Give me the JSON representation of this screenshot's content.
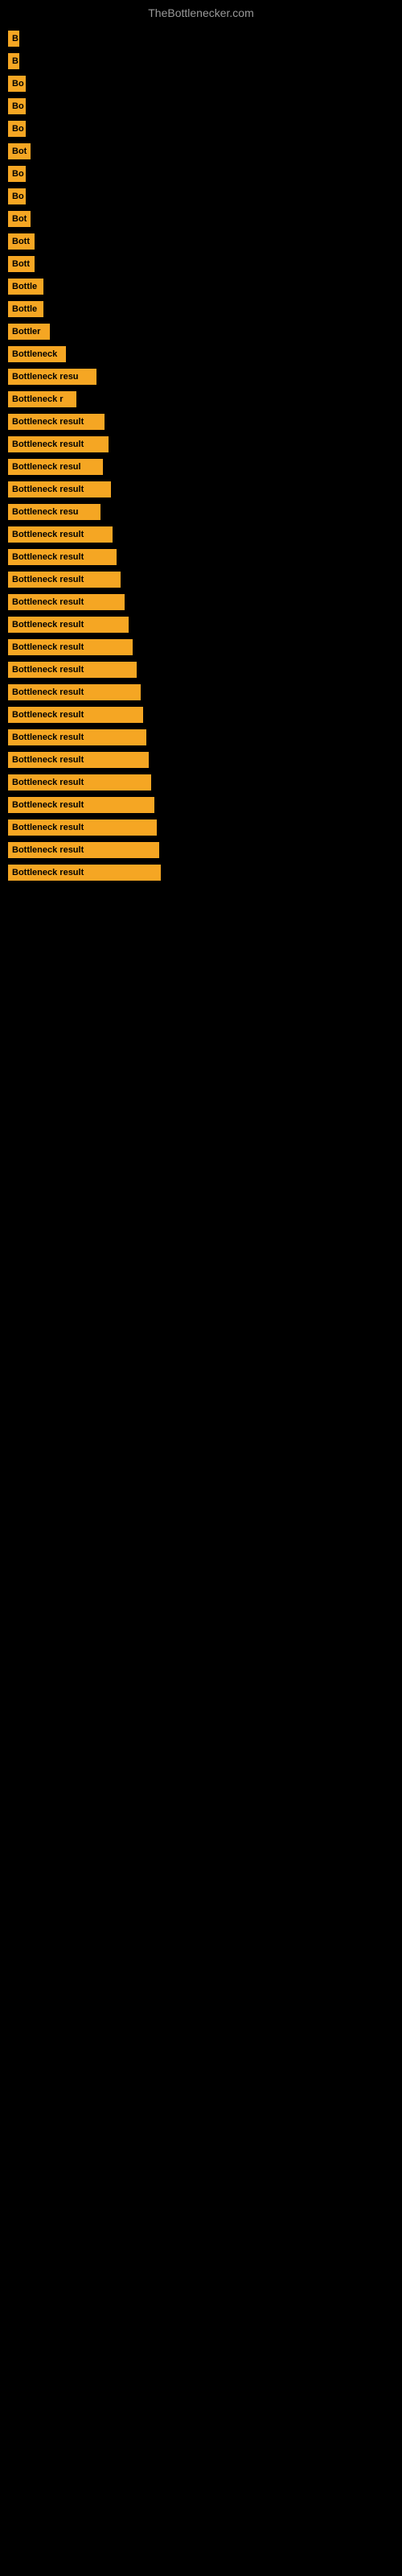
{
  "site": {
    "title": "TheBottlenecker.com"
  },
  "bars": [
    {
      "id": 1,
      "label": "B",
      "width": 14
    },
    {
      "id": 2,
      "label": "B",
      "width": 14
    },
    {
      "id": 3,
      "label": "Bo",
      "width": 22
    },
    {
      "id": 4,
      "label": "Bo",
      "width": 22
    },
    {
      "id": 5,
      "label": "Bo",
      "width": 22
    },
    {
      "id": 6,
      "label": "Bot",
      "width": 28
    },
    {
      "id": 7,
      "label": "Bo",
      "width": 22
    },
    {
      "id": 8,
      "label": "Bo",
      "width": 22
    },
    {
      "id": 9,
      "label": "Bot",
      "width": 28
    },
    {
      "id": 10,
      "label": "Bott",
      "width": 33
    },
    {
      "id": 11,
      "label": "Bott",
      "width": 33
    },
    {
      "id": 12,
      "label": "Bottle",
      "width": 44
    },
    {
      "id": 13,
      "label": "Bottle",
      "width": 44
    },
    {
      "id": 14,
      "label": "Bottler",
      "width": 52
    },
    {
      "id": 15,
      "label": "Bottleneck",
      "width": 72
    },
    {
      "id": 16,
      "label": "Bottleneck resu",
      "width": 110
    },
    {
      "id": 17,
      "label": "Bottleneck r",
      "width": 85
    },
    {
      "id": 18,
      "label": "Bottleneck result",
      "width": 120
    },
    {
      "id": 19,
      "label": "Bottleneck result",
      "width": 125
    },
    {
      "id": 20,
      "label": "Bottleneck resul",
      "width": 118
    },
    {
      "id": 21,
      "label": "Bottleneck result",
      "width": 128
    },
    {
      "id": 22,
      "label": "Bottleneck resu",
      "width": 115
    },
    {
      "id": 23,
      "label": "Bottleneck result",
      "width": 130
    },
    {
      "id": 24,
      "label": "Bottleneck result",
      "width": 135
    },
    {
      "id": 25,
      "label": "Bottleneck result",
      "width": 140
    },
    {
      "id": 26,
      "label": "Bottleneck result",
      "width": 145
    },
    {
      "id": 27,
      "label": "Bottleneck result",
      "width": 150
    },
    {
      "id": 28,
      "label": "Bottleneck result",
      "width": 155
    },
    {
      "id": 29,
      "label": "Bottleneck result",
      "width": 160
    },
    {
      "id": 30,
      "label": "Bottleneck result",
      "width": 165
    },
    {
      "id": 31,
      "label": "Bottleneck result",
      "width": 168
    },
    {
      "id": 32,
      "label": "Bottleneck result",
      "width": 172
    },
    {
      "id": 33,
      "label": "Bottleneck result",
      "width": 175
    },
    {
      "id": 34,
      "label": "Bottleneck result",
      "width": 178
    },
    {
      "id": 35,
      "label": "Bottleneck result",
      "width": 182
    },
    {
      "id": 36,
      "label": "Bottleneck result",
      "width": 185
    },
    {
      "id": 37,
      "label": "Bottleneck result",
      "width": 188
    },
    {
      "id": 38,
      "label": "Bottleneck result",
      "width": 190
    }
  ]
}
